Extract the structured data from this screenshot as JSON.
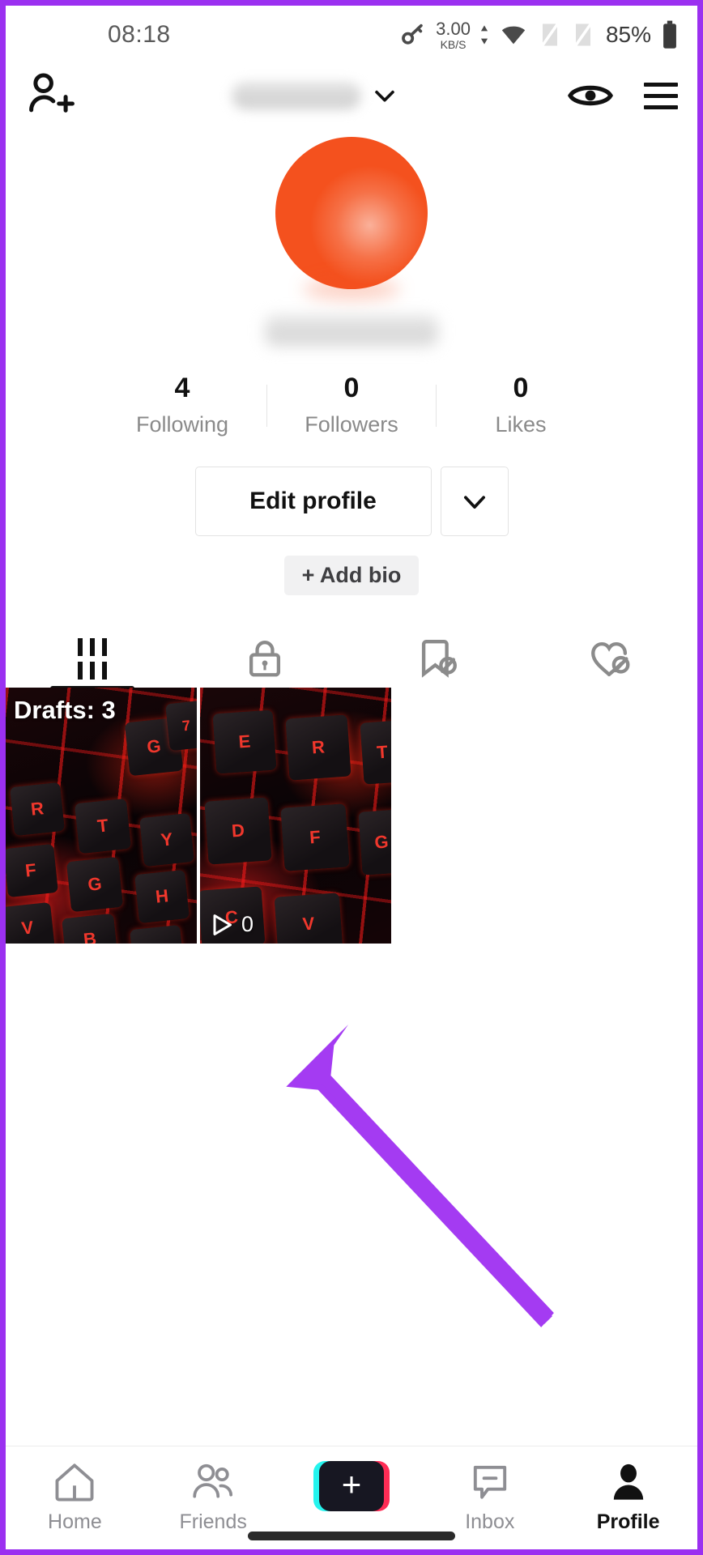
{
  "status_bar": {
    "time": "08:18",
    "net_speed_value": "3.00",
    "net_speed_unit": "KB/S",
    "battery_percent": "85%",
    "icons": [
      "key-icon",
      "wifi-icon",
      "sim-off-icon",
      "sim-off-icon",
      "battery-icon"
    ]
  },
  "header": {
    "add_friend_icon": "add-friend-icon",
    "username_masked": "",
    "chevron_icon": "chevron-down-icon",
    "eye_icon": "eye-icon",
    "menu_icon": "hamburger-menu-icon"
  },
  "profile": {
    "avatar_color": "#F4511E",
    "display_name_masked": "",
    "stats": [
      {
        "count": "4",
        "label": "Following"
      },
      {
        "count": "0",
        "label": "Followers"
      },
      {
        "count": "0",
        "label": "Likes"
      }
    ],
    "edit_profile_label": "Edit profile",
    "more_caret_icon": "chevron-down-icon",
    "add_bio_label": "+ Add bio"
  },
  "tabs": [
    {
      "name": "posts",
      "icon": "grid-icon",
      "active": true
    },
    {
      "name": "private",
      "icon": "lock-icon",
      "active": false
    },
    {
      "name": "saved",
      "icon": "bookmark-hidden-icon",
      "active": false
    },
    {
      "name": "liked",
      "icon": "heart-hidden-icon",
      "active": false
    }
  ],
  "videos": [
    {
      "badge": "Drafts: 3",
      "play_count": null,
      "play_icon": null
    },
    {
      "badge": null,
      "play_count": "0",
      "play_icon": "play-icon"
    }
  ],
  "annotation": {
    "arrow_color": "#A43BF2",
    "points_at": "second-video-thumbnail"
  },
  "bottom_nav": [
    {
      "label": "Home",
      "icon": "home-icon",
      "active": false
    },
    {
      "label": "Friends",
      "icon": "friends-icon",
      "active": false
    },
    {
      "label": "",
      "icon": "create-plus-icon",
      "active": false
    },
    {
      "label": "Inbox",
      "icon": "inbox-icon",
      "active": false
    },
    {
      "label": "Profile",
      "icon": "person-icon",
      "active": true
    }
  ],
  "colors": {
    "device_border": "#9B30F0",
    "tiktok_cyan": "#25F4EE",
    "tiktok_pink": "#FE2C55",
    "avatar_orange": "#F4511E"
  }
}
